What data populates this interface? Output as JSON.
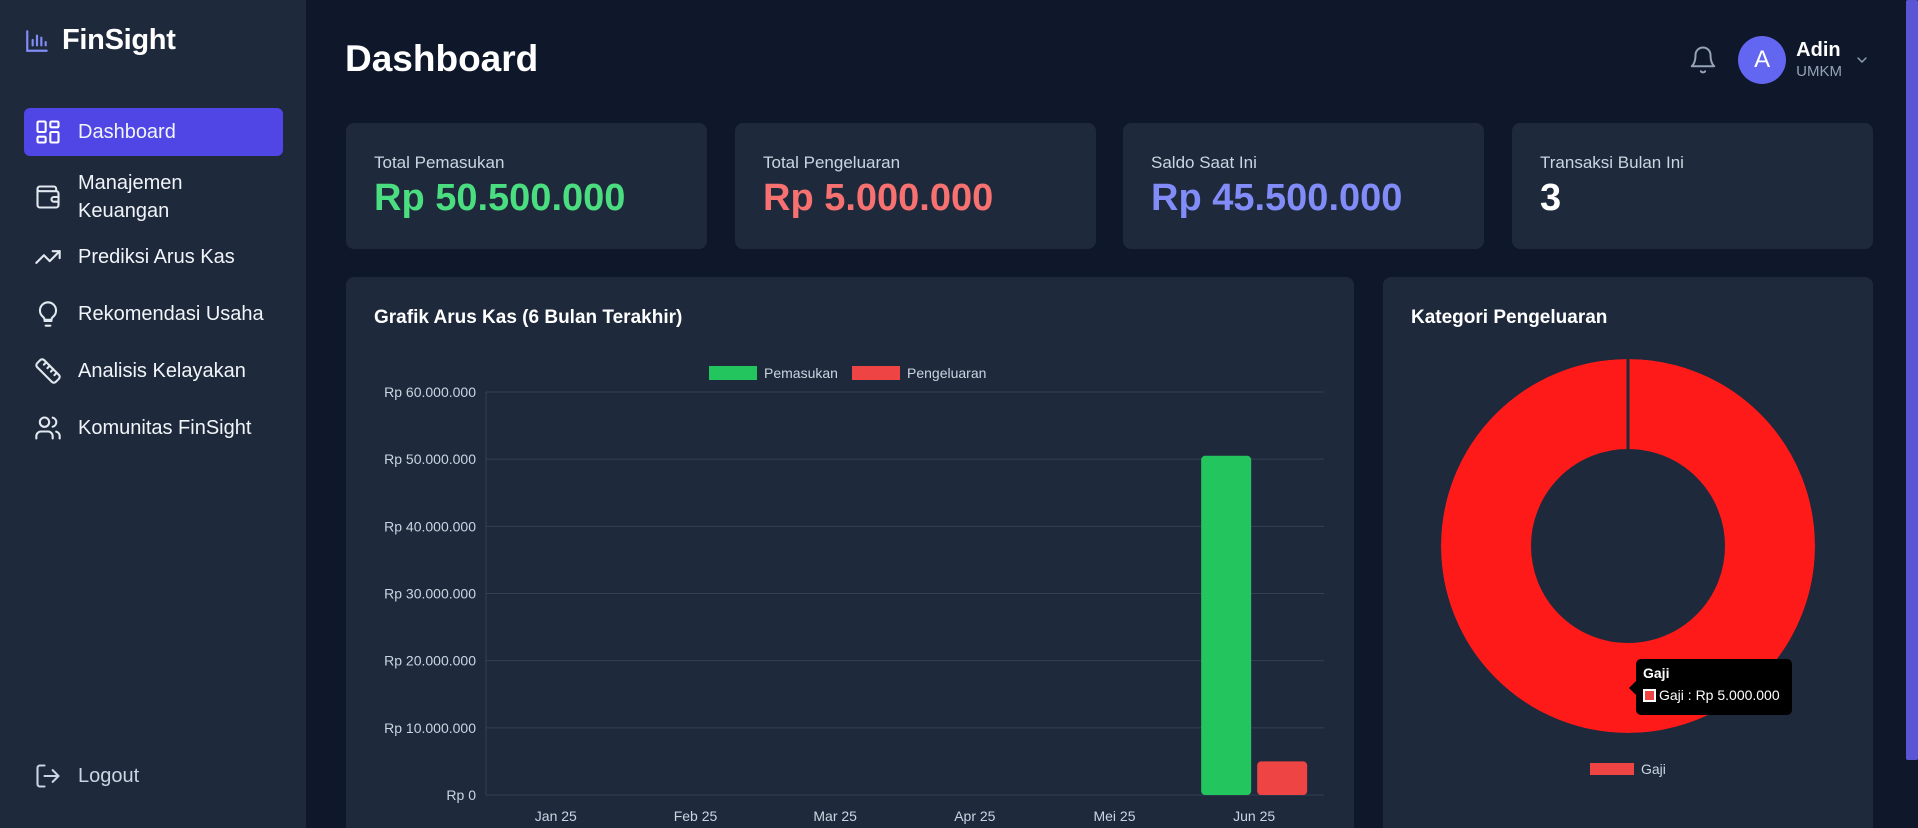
{
  "brand": {
    "name": "FinSight",
    "icon": "bar-chart-icon"
  },
  "sidebar": {
    "items": [
      {
        "label": "Dashboard",
        "icon": "dashboard-grid-icon",
        "active": true
      },
      {
        "label": "Manajemen Keuangan",
        "icon": "wallet-icon",
        "active": false
      },
      {
        "label": "Prediksi Arus Kas",
        "icon": "trending-up-icon",
        "active": false
      },
      {
        "label": "Rekomendasi Usaha",
        "icon": "lightbulb-icon",
        "active": false
      },
      {
        "label": "Analisis Kelayakan",
        "icon": "ruler-icon",
        "active": false
      },
      {
        "label": "Komunitas FinSight",
        "icon": "users-icon",
        "active": false
      }
    ],
    "logout_label": "Logout"
  },
  "header": {
    "title": "Dashboard",
    "user": {
      "initial": "A",
      "name": "Adin",
      "role": "UMKM"
    }
  },
  "stats": [
    {
      "label": "Total Pemasukan",
      "value": "Rp 50.500.000",
      "color": "#4ade80"
    },
    {
      "label": "Total Pengeluaran",
      "value": "Rp 5.000.000",
      "color": "#f87171"
    },
    {
      "label": "Saldo Saat Ini",
      "value": "Rp 45.500.000",
      "color": "#818cf8"
    },
    {
      "label": "Transaksi Bulan Ini",
      "value": "3",
      "color": "#ffffff"
    }
  ],
  "colors": {
    "accent": "#4f46e5",
    "income": "#22c55e",
    "expense": "#ef4444",
    "pie": "#ff1a1a"
  },
  "chart_data": [
    {
      "type": "bar",
      "title": "Grafik Arus Kas (6 Bulan Terakhir)",
      "categories": [
        "Jan 25",
        "Feb 25",
        "Mar 25",
        "Apr 25",
        "Mei 25",
        "Jun 25"
      ],
      "series": [
        {
          "name": "Pemasukan",
          "color": "#22c55e",
          "values": [
            0,
            0,
            0,
            0,
            0,
            50500000
          ]
        },
        {
          "name": "Pengeluaran",
          "color": "#ef4444",
          "values": [
            0,
            0,
            0,
            0,
            0,
            5000000
          ]
        }
      ],
      "ylim": [
        0,
        60000000
      ],
      "yticks": [
        {
          "value": 60000000,
          "label": "Rp 60.000.000"
        },
        {
          "value": 50000000,
          "label": "Rp 50.000.000"
        },
        {
          "value": 40000000,
          "label": "Rp 40.000.000"
        },
        {
          "value": 30000000,
          "label": "Rp 30.000.000"
        },
        {
          "value": 20000000,
          "label": "Rp 20.000.000"
        },
        {
          "value": 10000000,
          "label": "Rp 10.000.000"
        },
        {
          "value": 0,
          "label": "Rp 0"
        }
      ],
      "legend_position": "top-center",
      "grid": true
    },
    {
      "type": "pie",
      "variant": "doughnut",
      "title": "Kategori Pengeluaran",
      "slices": [
        {
          "label": "Gaji",
          "value": 5000000,
          "color": "#ff1a1a"
        }
      ],
      "legend_position": "bottom-center",
      "tooltip": {
        "title": "Gaji",
        "text": "Gaji : Rp 5.000.000"
      }
    }
  ]
}
